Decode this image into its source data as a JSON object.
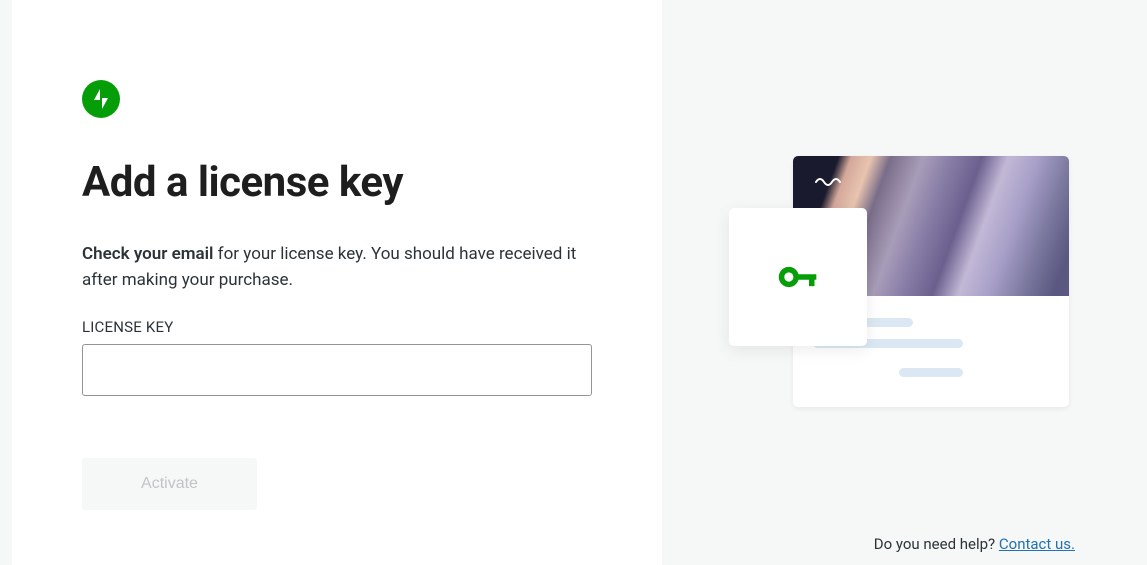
{
  "header": {
    "title": "Add a license key"
  },
  "instruction": {
    "strong": "Check your email",
    "rest": " for your license key. You should have received it after making your purchase."
  },
  "form": {
    "license_key_label": "LICENSE KEY",
    "license_key_value": "",
    "activate_label": "Activate"
  },
  "help": {
    "question": "Do you need help? ",
    "link_text": "Contact us."
  },
  "colors": {
    "brand_green": "#069e08",
    "link_blue": "#2271b1"
  }
}
